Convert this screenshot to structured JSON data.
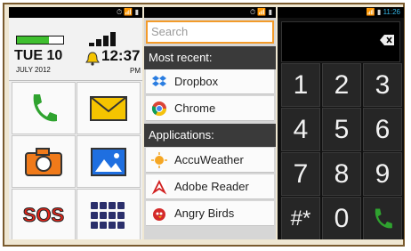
{
  "screen1": {
    "status_text": "⏱ 📶 ▮",
    "status_time": "",
    "battery_level": 0.7,
    "date_main": "TUE 10",
    "date_sub": "JULY 2012",
    "time": "12:37",
    "ampm": "PM",
    "tiles": [
      {
        "name": "phone-tile",
        "icon": "phone-icon"
      },
      {
        "name": "messages-tile",
        "icon": "envelope-icon"
      },
      {
        "name": "camera-tile",
        "icon": "camera-icon"
      },
      {
        "name": "gallery-tile",
        "icon": "picture-icon"
      },
      {
        "name": "sos-tile",
        "label": "SOS"
      },
      {
        "name": "apps-tile",
        "icon": "grid-icon"
      }
    ],
    "colors": {
      "green": "#2fa32f",
      "yellow": "#f5c400",
      "orange": "#f07a1a",
      "blue": "#1f6fe0",
      "red": "#e0261b",
      "navy": "#2b2f6b"
    }
  },
  "screen2": {
    "status_text": "⏱ 📶 ▮",
    "search_placeholder": "Search",
    "recent_header": "Most recent:",
    "recent": [
      {
        "label": "Dropbox",
        "icon": "dropbox-icon"
      },
      {
        "label": "Chrome",
        "icon": "chrome-icon"
      }
    ],
    "apps_header": "Applications:",
    "apps": [
      {
        "label": "AccuWeather",
        "icon": "sun-icon"
      },
      {
        "label": "Adobe Reader",
        "icon": "adobe-icon"
      },
      {
        "label": "Angry Birds",
        "icon": "bird-icon"
      }
    ]
  },
  "screen3": {
    "status_text": "📶 ▮",
    "status_time": "11:26",
    "keys": [
      "1",
      "2",
      "3",
      "4",
      "5",
      "6",
      "7",
      "8",
      "9",
      "#*",
      "0"
    ]
  }
}
